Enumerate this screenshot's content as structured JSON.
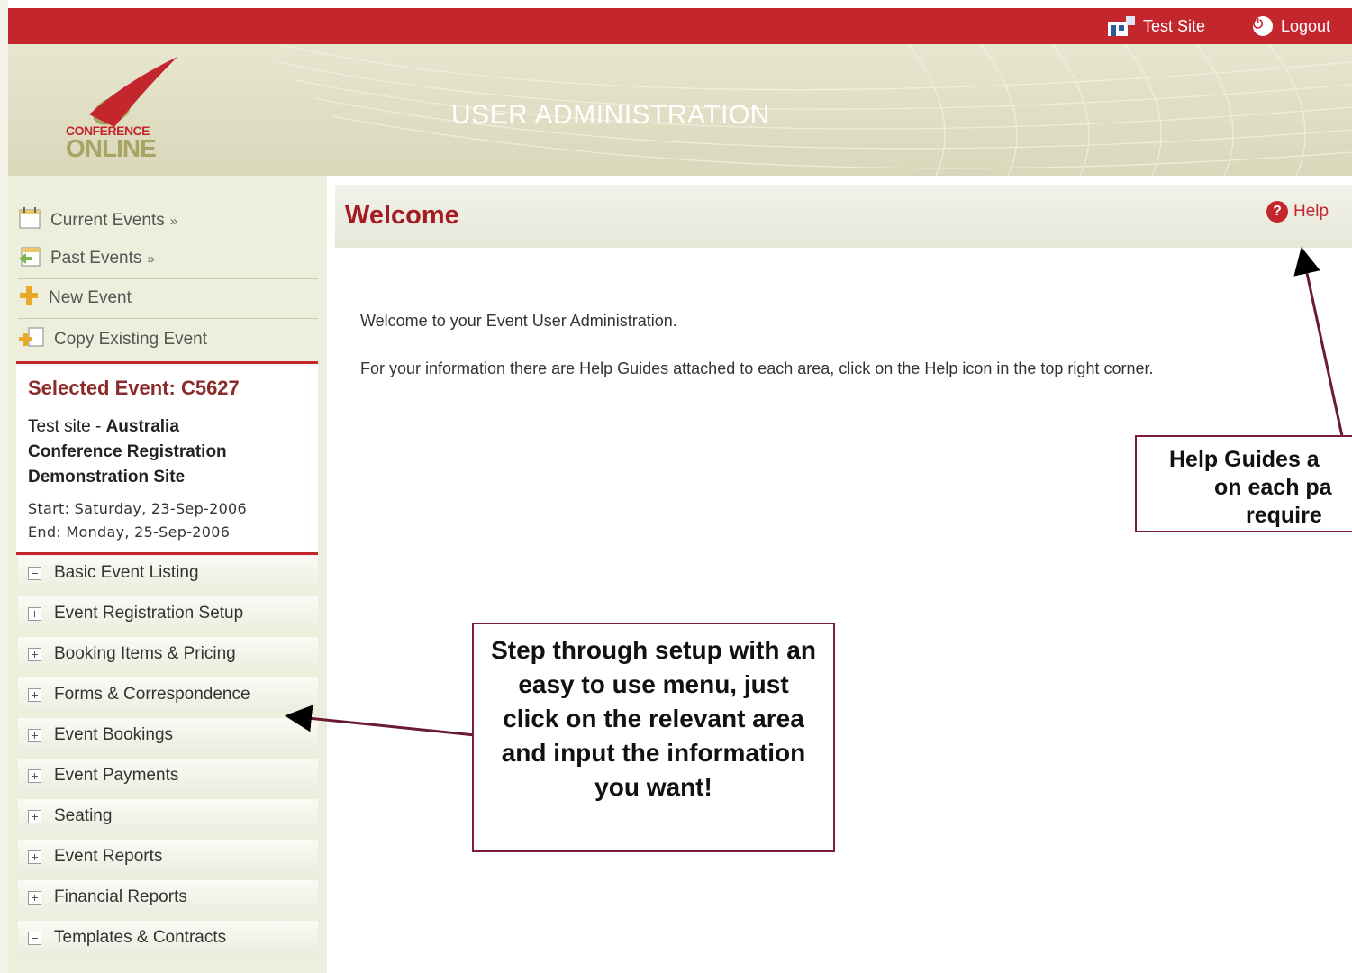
{
  "topbar": {
    "site_label": "Test Site",
    "logout_label": "Logout",
    "color": "#c4262e"
  },
  "banner": {
    "logo_line1": "CONFERENCE",
    "logo_line2": "ONLINE",
    "title": "USER ADMINISTRATION"
  },
  "sidebar": {
    "nav": [
      {
        "label": "Current Events",
        "arrow": "»",
        "icon": "calendar-icon"
      },
      {
        "label": "Past Events",
        "arrow": "»",
        "icon": "calendar-back-icon"
      },
      {
        "label": "New Event",
        "icon": "plus-icon"
      },
      {
        "label": "Copy Existing Event",
        "icon": "copy-icon"
      }
    ],
    "selected": {
      "title": "Selected Event: C5627",
      "prefix": "Test site - ",
      "name_line1": "Australia",
      "name_line2": "Conference Registration",
      "name_line3": "Demonstration Site",
      "start": "Start: Saturday, 23-Sep-2006",
      "end": "End: Monday, 25-Sep-2006"
    },
    "menu": [
      {
        "label": "Basic Event Listing",
        "state": "expanded"
      },
      {
        "label": "Event Registration Setup",
        "state": "collapsed"
      },
      {
        "label": "Booking Items & Pricing",
        "state": "collapsed"
      },
      {
        "label": "Forms & Correspondence",
        "state": "collapsed"
      },
      {
        "label": "Event Bookings",
        "state": "collapsed"
      },
      {
        "label": "Event Payments",
        "state": "collapsed"
      },
      {
        "label": "Seating",
        "state": "collapsed"
      },
      {
        "label": "Event Reports",
        "state": "collapsed"
      },
      {
        "label": "Financial Reports",
        "state": "collapsed"
      },
      {
        "label": "Templates & Contracts",
        "state": "expanded"
      }
    ]
  },
  "main": {
    "title": "Welcome",
    "help_label": "Help",
    "para1": "Welcome to your Event User Administration.",
    "para2": "For your information there are Help Guides attached to each area, click on the Help icon in the top right corner."
  },
  "callouts": {
    "menu_tip": "Step through setup with an easy to use menu, just click on the relevant area and input the information you want!",
    "help_tip_line1": "Help Guides a",
    "help_tip_line2": "on each pa",
    "help_tip_line3": "require"
  }
}
